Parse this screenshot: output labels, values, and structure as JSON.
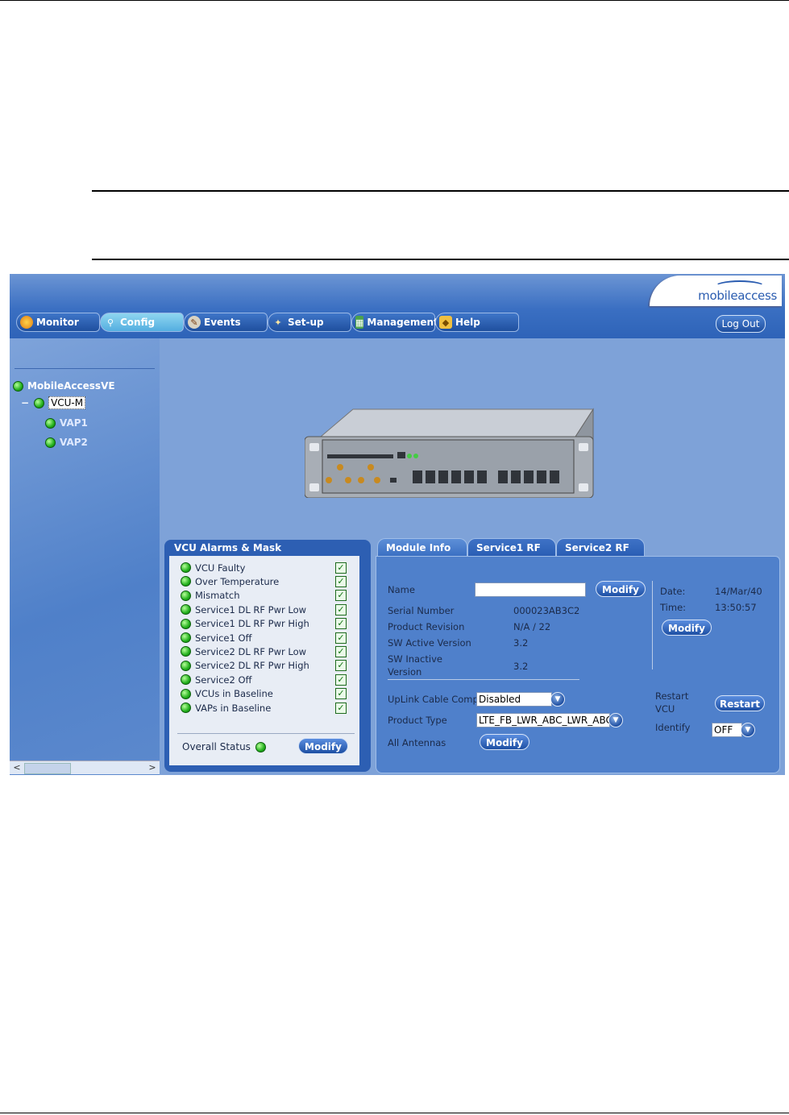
{
  "app": {
    "logo_text": "mobileaccess",
    "tabs": [
      {
        "label": "Monitor",
        "icon": "monitor-icon"
      },
      {
        "label": "Config",
        "icon": "wrench-icon"
      },
      {
        "label": "Events",
        "icon": "events-icon"
      },
      {
        "label": "Set-up",
        "icon": "wand-icon"
      },
      {
        "label": "Management",
        "icon": "management-icon"
      },
      {
        "label": "Help",
        "icon": "help-icon"
      }
    ],
    "active_tab": "Config",
    "logout_label": "Log Out"
  },
  "tree": {
    "root": "MobileAccessVE",
    "collapse_glyph": "−",
    "vcu": "VCU-M",
    "vaps": [
      "VAP1",
      "VAP2"
    ]
  },
  "alarms": {
    "title": "VCU Alarms & Mask",
    "items": [
      "VCU Faulty",
      "Over Temperature",
      "Mismatch",
      "Service1 DL RF Pwr Low",
      "Service1 DL RF Pwr High",
      "Service1 Off",
      "Service2 DL RF Pwr Low",
      "Service2 DL RF Pwr High",
      "Service2 Off",
      "VCUs in Baseline",
      "VAPs in Baseline"
    ],
    "check_glyph": "✓",
    "overall_status_label": "Overall Status",
    "modify_label": "Modify"
  },
  "module": {
    "tabs": [
      "Module Info",
      "Service1 RF",
      "Service2 RF"
    ],
    "name_label": "Name",
    "name_value": "",
    "modify_label": "Modify",
    "serial_label": "Serial Number",
    "serial_value": "000023AB3C2",
    "revision_label": "Product Revision",
    "revision_value": "N/A / 22",
    "sw_active_label": "SW Active Version",
    "sw_active_value": "3.2",
    "sw_inactive_label_1": "SW Inactive",
    "sw_inactive_label_2": "Version",
    "sw_inactive_value": "3.2",
    "date_label": "Date:",
    "date_value": "14/Mar/40",
    "time_label": "Time:",
    "time_value": "13:50:57",
    "datetime_modify_label": "Modify",
    "uplink_label": "UpLink Cable Comp.",
    "uplink_value": "Disabled",
    "product_type_label": "Product Type",
    "product_type_value": "LTE_FB_LWR_ABC_LWR_ABC",
    "all_antennas_label": "All Antennas",
    "antennas_modify_label": "Modify",
    "restart_label_1": "Restart",
    "restart_label_2": "VCU",
    "restart_button": "Restart",
    "identify_label": "Identify",
    "identify_value": "OFF"
  },
  "colors": {
    "accent": "#2d5fb3",
    "status_green": "#22b01c",
    "panel_bg": "#e8edf5"
  }
}
